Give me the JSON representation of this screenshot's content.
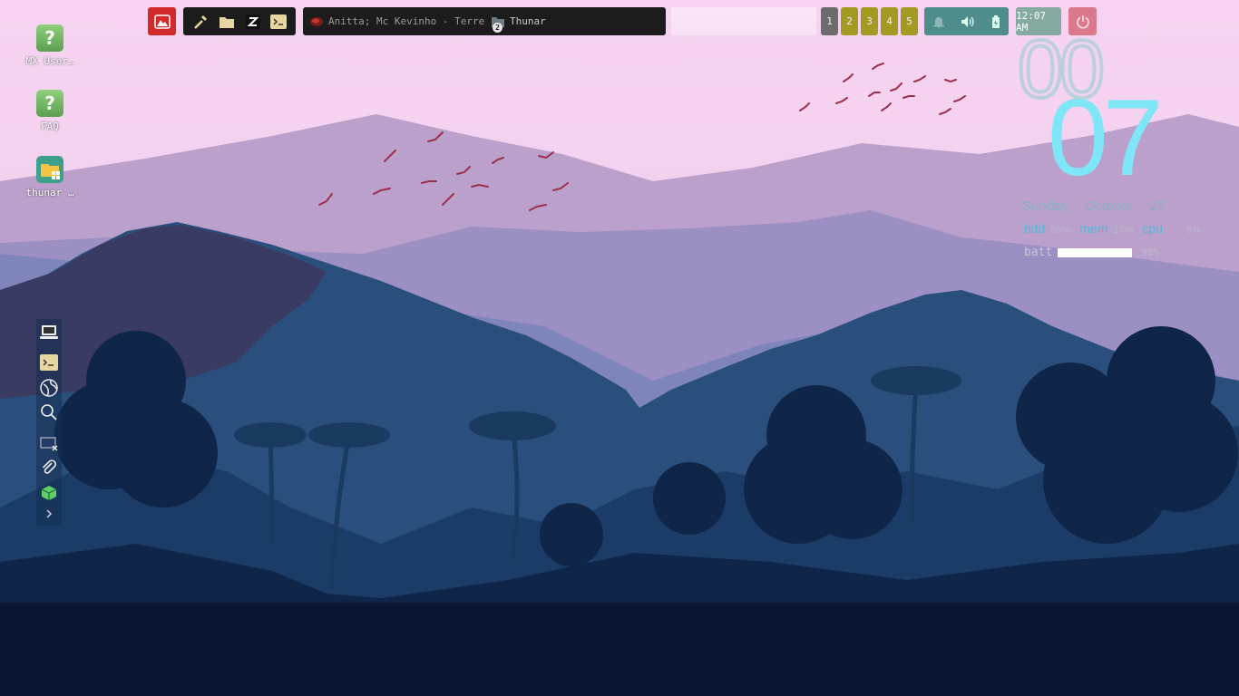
{
  "panel": {
    "menu_icon": "mountain-app-menu-icon",
    "launchers": [
      "screenshot-tool-icon",
      "file-manager-icon",
      "z-app-icon",
      "terminal-icon"
    ],
    "tasks": [
      {
        "label": "Anitta; Mc Kevinho - Terrem…",
        "icon": "media-player-icon",
        "active": false
      },
      {
        "label": "Thunar",
        "icon": "folder-icon",
        "active": true,
        "badge": "2"
      }
    ],
    "workspaces": [
      "1",
      "2",
      "3",
      "4",
      "5"
    ],
    "current_workspace": "1",
    "tray_icons": [
      "notification-bell-icon",
      "volume-icon",
      "battery-icon"
    ],
    "clock": "12:07 AM",
    "power_icon": "power-icon",
    "colors": {
      "menu": "#d12a2a",
      "workspace": "#a39a22",
      "tray": "#4f8c8c",
      "clock": "#86a9a2",
      "power": "#d9798b"
    }
  },
  "desktop_icons": [
    {
      "label": "MX User…",
      "icon": "help-icon"
    },
    {
      "label": "FAQ",
      "icon": "help-icon"
    },
    {
      "label": "thunar …",
      "icon": "folder-grid-icon"
    }
  ],
  "conky": {
    "hour": "00",
    "minute": "07",
    "day": "Sunday",
    "date": "October 27",
    "stats": [
      {
        "key": "hdd",
        "value": "59%"
      },
      {
        "key": "mem",
        "value": "17%"
      },
      {
        "key": "cpu",
        "value": "5%"
      }
    ],
    "batt_label": "batt",
    "batt_value": "99%",
    "batt_fraction": 0.99
  },
  "dock": [
    {
      "icon": "laptop-icon"
    },
    {
      "icon": "terminal-icon"
    },
    {
      "icon": "globe-icon"
    },
    {
      "icon": "search-icon"
    },
    {
      "icon": "screen-close-icon"
    },
    {
      "icon": "paperclip-icon"
    },
    {
      "icon": "package-icon"
    },
    {
      "icon": "chevron-right-icon"
    }
  ]
}
